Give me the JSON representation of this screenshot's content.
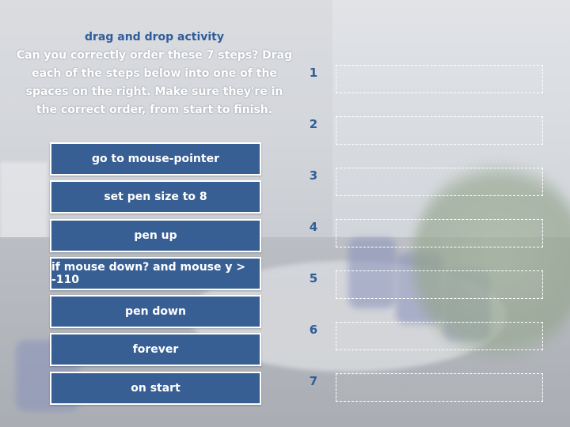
{
  "instructions": {
    "title": "drag and drop activity",
    "body": "Can you correctly order these 7 steps? Drag each of the steps below into one of the spaces on the right. Make sure they're in the correct order, from start to finish."
  },
  "drag_items": [
    "go to mouse-pointer",
    "set pen size to 8",
    "pen up",
    "if mouse down? and mouse y > -110",
    "pen down",
    "forever",
    "on start"
  ],
  "drop_slots": [
    "1",
    "2",
    "3",
    "4",
    "5",
    "6",
    "7"
  ],
  "colors": {
    "accent": "#2f5d99",
    "item_bg": "#385f94",
    "item_border": "#ffffff"
  }
}
